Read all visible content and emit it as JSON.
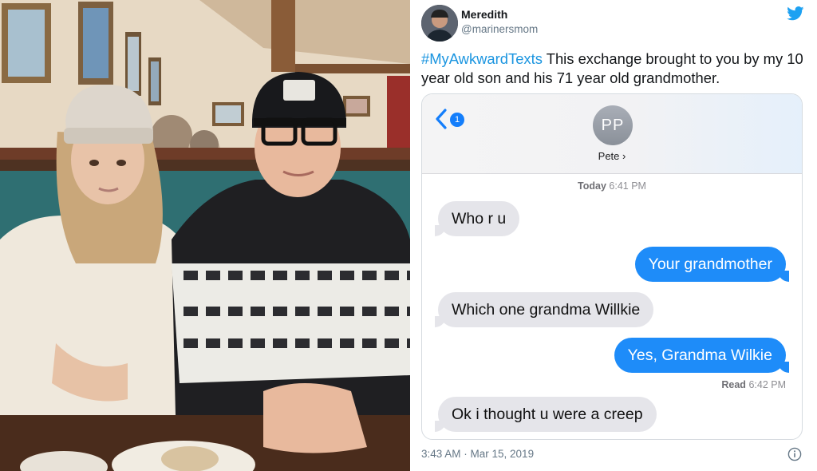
{
  "tweet": {
    "author_name": "Meredith",
    "author_handle": "@marinersmom",
    "hashtag": "#MyAwkwardTexts",
    "text": " This exchange brought to you by my 10 year old son and his 71 year old grandmother.",
    "time": "3:43 AM · Mar 15, 2019"
  },
  "imessage": {
    "unread_count": "1",
    "contact_initials": "PP",
    "contact_name": "Pete ›",
    "date_label": "Today",
    "time_label": "6:41 PM",
    "read_label": "Read",
    "read_time": "6:42 PM",
    "messages": [
      {
        "direction": "in",
        "text": "Who r u"
      },
      {
        "direction": "out",
        "text": "Your grandmother"
      },
      {
        "direction": "in",
        "text": "Which one grandma Willkie"
      },
      {
        "direction": "out",
        "text": "Yes, Grandma Wilkie"
      },
      {
        "direction": "in",
        "text": "Ok i thought u were a creep"
      }
    ]
  },
  "colors": {
    "twitter_blue": "#1da1f2",
    "hashtag_blue": "#1b95e0",
    "imessage_blue": "#1e8cf9",
    "incoming_gray": "#e5e5ea"
  }
}
